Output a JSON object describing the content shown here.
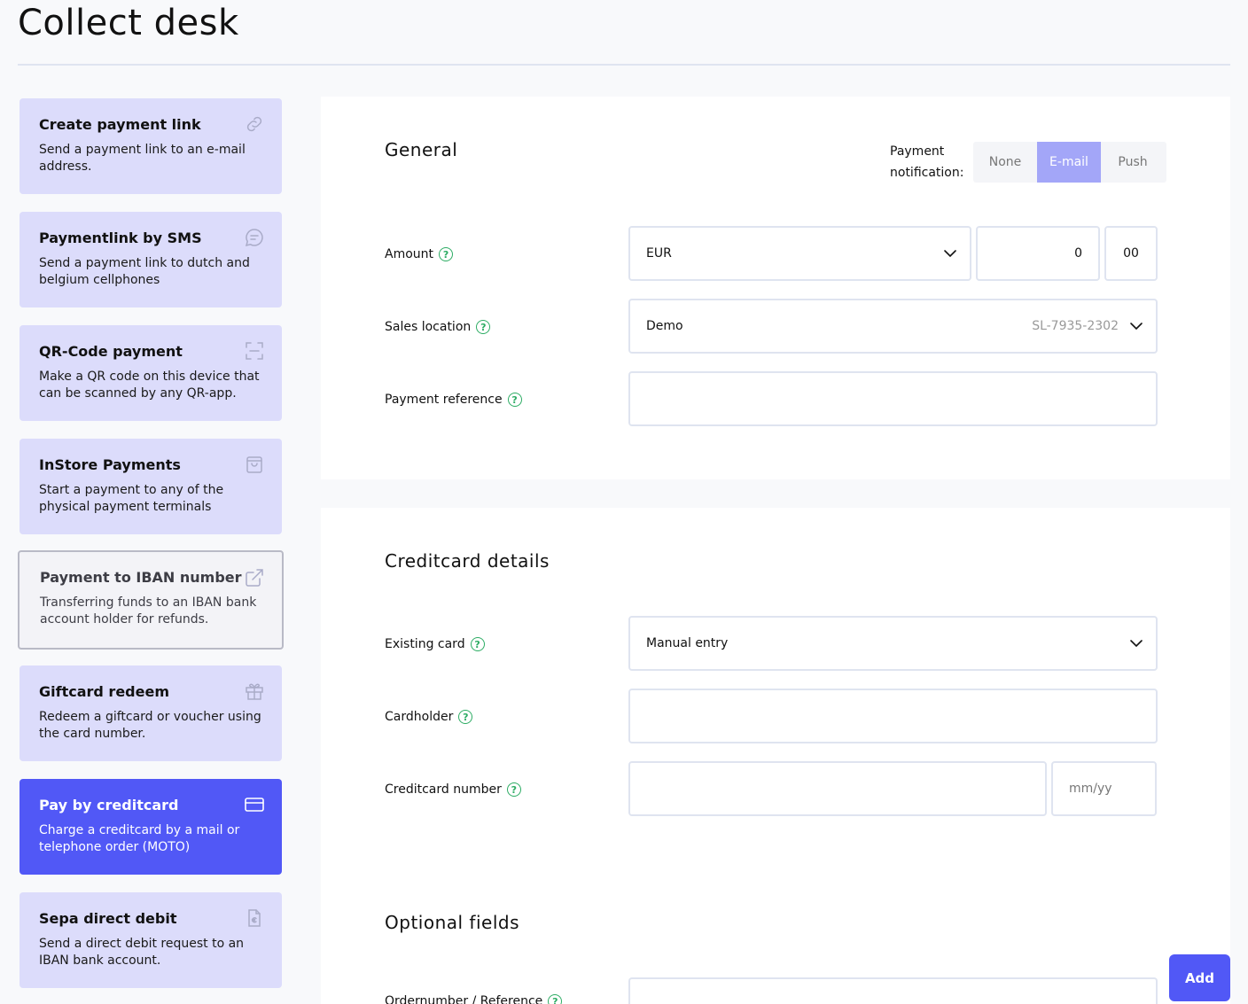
{
  "page": {
    "title": "Collect desk"
  },
  "sidebar": {
    "items": [
      {
        "title": "Create payment link",
        "desc": "Send a payment link to an e-mail address.",
        "icon": "link-icon"
      },
      {
        "title": "Paymentlink by SMS",
        "desc": "Send a payment link to dutch and belgium cellphones",
        "icon": "chat-icon"
      },
      {
        "title": "QR-Code payment",
        "desc": "Make a QR code on this device that can be scanned by any QR-app.",
        "icon": "qr-scan-icon"
      },
      {
        "title": "InStore Payments",
        "desc": "Start a payment to any of the physical payment terminals",
        "icon": "bag-icon"
      },
      {
        "title": "Payment to IBAN number",
        "desc": "Transferring funds to an IBAN bank account holder for refunds.",
        "icon": "external-link-icon"
      },
      {
        "title": "Giftcard redeem",
        "desc": "Redeem a giftcard or voucher using the card number.",
        "icon": "gift-icon"
      },
      {
        "title": "Pay by creditcard",
        "desc": "Charge a creditcard by a mail or telephone order (MOTO)",
        "icon": "credit-card-icon"
      },
      {
        "title": "Sepa direct debit",
        "desc": "Send a direct debit request to an IBAN bank account.",
        "icon": "euro-document-icon"
      }
    ]
  },
  "general": {
    "title": "General",
    "notification": {
      "label_line1": "Payment",
      "label_line2": "notification:",
      "options": [
        "None",
        "E-mail",
        "Push"
      ],
      "selected": "E-mail"
    },
    "amount": {
      "label": "Amount",
      "currency": "EUR",
      "whole": "0",
      "cents": "00"
    },
    "sales_location": {
      "label": "Sales location",
      "value": "Demo",
      "code": "SL-7935-2302"
    },
    "payment_reference": {
      "label": "Payment reference",
      "value": ""
    }
  },
  "creditcard": {
    "title": "Creditcard details",
    "existing_card": {
      "label": "Existing card",
      "value": "Manual entry"
    },
    "cardholder": {
      "label": "Cardholder",
      "value": ""
    },
    "number": {
      "label": "Creditcard number",
      "value": "",
      "expiry_placeholder": "mm/yy"
    }
  },
  "optional": {
    "title": "Optional fields",
    "order_reference": {
      "label": "Ordernumber / Reference"
    }
  },
  "actions": {
    "add_label": "Add"
  },
  "colors": {
    "accent": "#5158f6",
    "card_bg": "#dcdcfb",
    "help": "#2dac64",
    "segment_active": "#a3a6f8"
  }
}
